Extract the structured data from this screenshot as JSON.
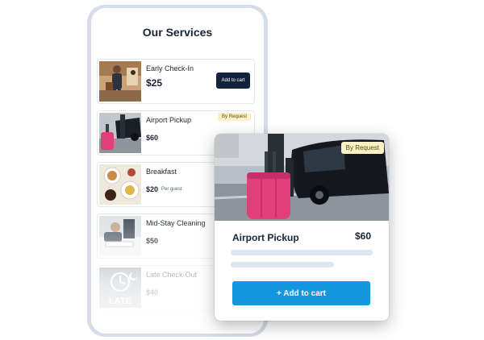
{
  "screen": {
    "title": "Our Services"
  },
  "services": [
    {
      "name": "Early Check-In",
      "price": "$25",
      "button": "Add to cart"
    },
    {
      "name": "Airport Pickup",
      "price": "$60",
      "badge": "By Request"
    },
    {
      "name": "Breakfast",
      "price": "$20",
      "unit": "Per guest"
    },
    {
      "name": "Mid-Stay Cleaning",
      "price": "$50"
    },
    {
      "name": "Late Check-Out",
      "price": "$40",
      "thumb_caption": "LATE"
    }
  ],
  "detail": {
    "badge": "By Request",
    "title": "Airport Pickup",
    "price": "$60",
    "cta": "+ Add to cart"
  },
  "colors": {
    "phone_frame": "#d4dde8",
    "dark_button": "#12233d",
    "accent_button": "#1596e0",
    "badge_bg": "#fbf1c4",
    "suitcase": "#e23f78"
  }
}
